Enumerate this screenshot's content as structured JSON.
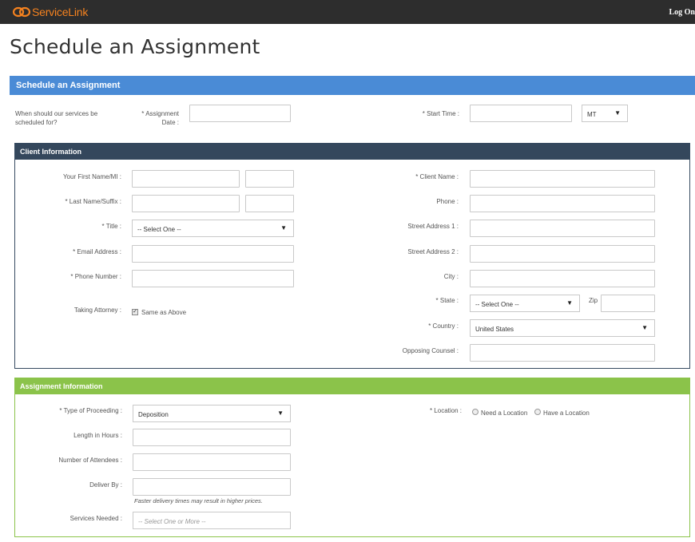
{
  "header": {
    "brand": "ServiceLink",
    "logon": "Log On"
  },
  "page": {
    "title": "Schedule an Assignment"
  },
  "schedule": {
    "section_title": "Schedule an Assignment",
    "question": "When should our services be scheduled for?",
    "assignment_date_label": "* Assignment Date :",
    "start_time_label": "* Start Time :",
    "timezone": "MT"
  },
  "client": {
    "section_title": "Client Information",
    "first_name_label": "Your First Name/MI :",
    "last_name_label": "* Last Name/Suffix :",
    "title_label": "* Title :",
    "title_value": "-- Select One --",
    "email_label": "* Email Address :",
    "phone_number_label": "* Phone Number :",
    "taking_attorney_label": "Taking Attorney :",
    "same_as_above_label": "Same as Above",
    "same_as_above_checked": true,
    "client_name_label": "* Client Name :",
    "phone_label": "Phone :",
    "street1_label": "Street Address 1 :",
    "street2_label": "Street Address 2 :",
    "city_label": "City :",
    "state_label": "* State :",
    "state_value": "-- Select One --",
    "zip_label": "Zip",
    "country_label": "* Country :",
    "country_value": "United States",
    "opposing_counsel_label": "Opposing Counsel :"
  },
  "assignment": {
    "section_title": "Assignment Information",
    "type_label": "* Type of Proceeding :",
    "type_value": "Deposition",
    "length_label": "Length in Hours :",
    "attendees_label": "Number of Attendees :",
    "deliver_by_label": "Deliver By :",
    "deliver_hint": "Faster delivery times may result in higher prices.",
    "services_label": "Services Needed :",
    "services_placeholder": "-- Select One or More --",
    "location_label": "* Location :",
    "need_location": "Need a Location",
    "have_location": "Have a Location"
  },
  "colors": {
    "brand_orange": "#f5821f",
    "schedule_blue": "#4a8bd6",
    "client_navy": "#34475c",
    "assignment_green": "#8bc34a"
  }
}
